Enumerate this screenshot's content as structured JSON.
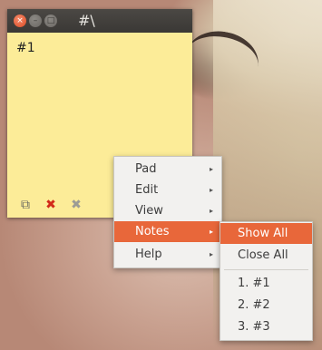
{
  "note": {
    "title": "#\\",
    "body": "#1",
    "title_buttons": {
      "close_glyph": "×",
      "minimize_glyph": "–",
      "maximize_glyph": "□"
    },
    "toolbar": {
      "new_glyph": "⧉",
      "delete_glyph": "✖",
      "close_glyph": "✖"
    }
  },
  "menu": {
    "items": [
      {
        "label": "Pad"
      },
      {
        "label": "Edit"
      },
      {
        "label": "View"
      },
      {
        "label": "Notes"
      },
      {
        "label": "Help"
      }
    ],
    "active_index": 3,
    "submenu_arrow": "▸"
  },
  "notes_submenu": {
    "show_all": "Show All",
    "close_all": "Close All",
    "notes": [
      "1. #1",
      "2. #2",
      "3. #3"
    ]
  },
  "colors": {
    "note_background": "#fcec98",
    "menu_highlight": "#e8673a",
    "title_bar": "#3a3835"
  }
}
